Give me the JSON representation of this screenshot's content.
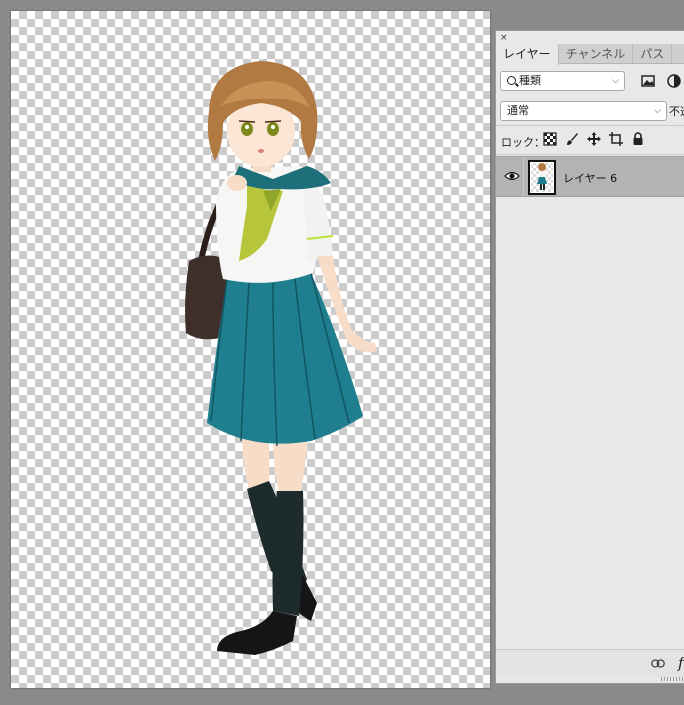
{
  "canvas": {
    "background": "transparency-checkerboard",
    "content": "anime schoolgirl illustration"
  },
  "panel": {
    "close_glyph": "×",
    "tabs": [
      {
        "label": "レイヤー",
        "active": true
      },
      {
        "label": "チャンネル",
        "active": false
      },
      {
        "label": "パス",
        "active": false
      }
    ],
    "filter": {
      "icon": "search-icon",
      "label": "種類"
    },
    "filter_icons": [
      "image-filter-icon",
      "adjustment-filter-icon"
    ],
    "blend_mode": "通常",
    "opacity_label": "不透",
    "lock": {
      "label": "ロック：",
      "icons": [
        "lock-transparent-pixels-icon",
        "lock-image-pixels-icon",
        "lock-position-icon",
        "lock-artboard-icon",
        "lock-all-icon"
      ]
    },
    "layers": [
      {
        "name": "レイヤー 6",
        "visible": true,
        "selected": true
      }
    ],
    "footer": {
      "link_icon": "link-layers-icon",
      "fx_label": "f"
    }
  },
  "colors": {
    "app_background": "#8a8a8a",
    "panel_background": "#e8e8e8",
    "selected_row": "#b3b3b3"
  }
}
